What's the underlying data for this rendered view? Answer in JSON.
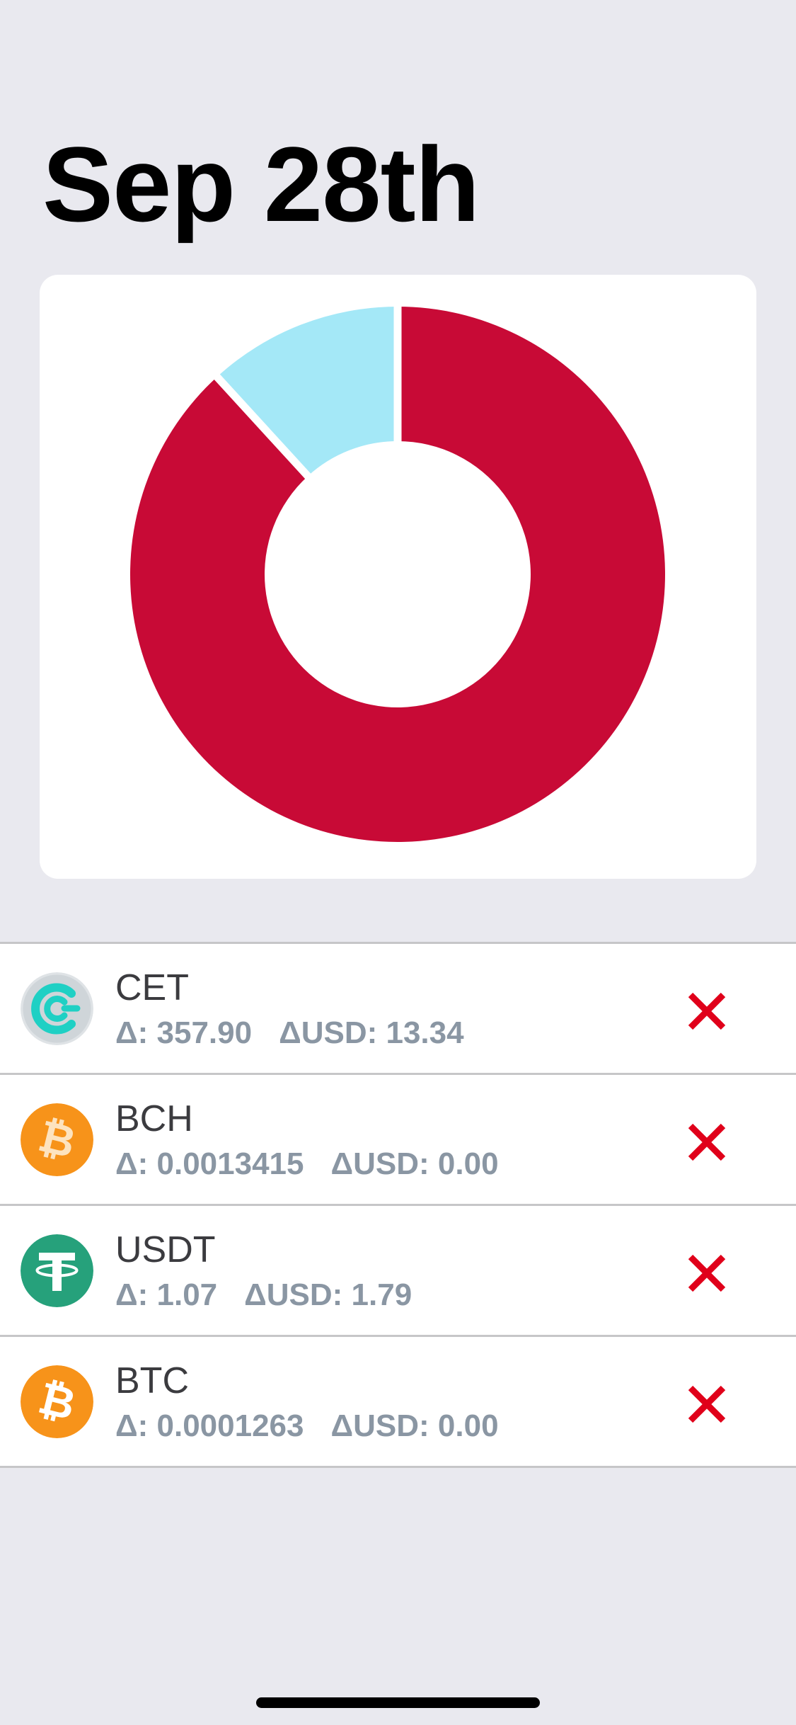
{
  "header": {
    "title": "Sep 28th"
  },
  "chart_data": {
    "type": "pie",
    "variant": "donut",
    "slices": [
      {
        "label": "",
        "value": 88.2,
        "color": "#c80a36"
      },
      {
        "label": "",
        "value": 11.8,
        "color": "#a4e8f7"
      }
    ],
    "start_angle_deg": 0,
    "legend": "none",
    "title": ""
  },
  "assets": [
    {
      "symbol": "CET",
      "delta_label": "Δ: 357.90",
      "usd_label": "ΔUSD: 13.34",
      "icon": "coinex-icon",
      "icon_color": "#1fd0c4"
    },
    {
      "symbol": "BCH",
      "delta_label": "Δ: 0.0013415",
      "usd_label": "ΔUSD: 0.00",
      "icon": "bitcoin-cash-icon",
      "icon_color": "#f7931a"
    },
    {
      "symbol": "USDT",
      "delta_label": "Δ: 1.07",
      "usd_label": "ΔUSD: 1.79",
      "icon": "tether-icon",
      "icon_color": "#26a17b"
    },
    {
      "symbol": "BTC",
      "delta_label": "Δ: 0.0001263",
      "usd_label": "ΔUSD: 0.00",
      "icon": "bitcoin-icon",
      "icon_color": "#f7931a"
    }
  ],
  "colors": {
    "background": "#e9e9ef",
    "remove_icon": "#e0001a",
    "secondary_text": "#8a96a3"
  }
}
